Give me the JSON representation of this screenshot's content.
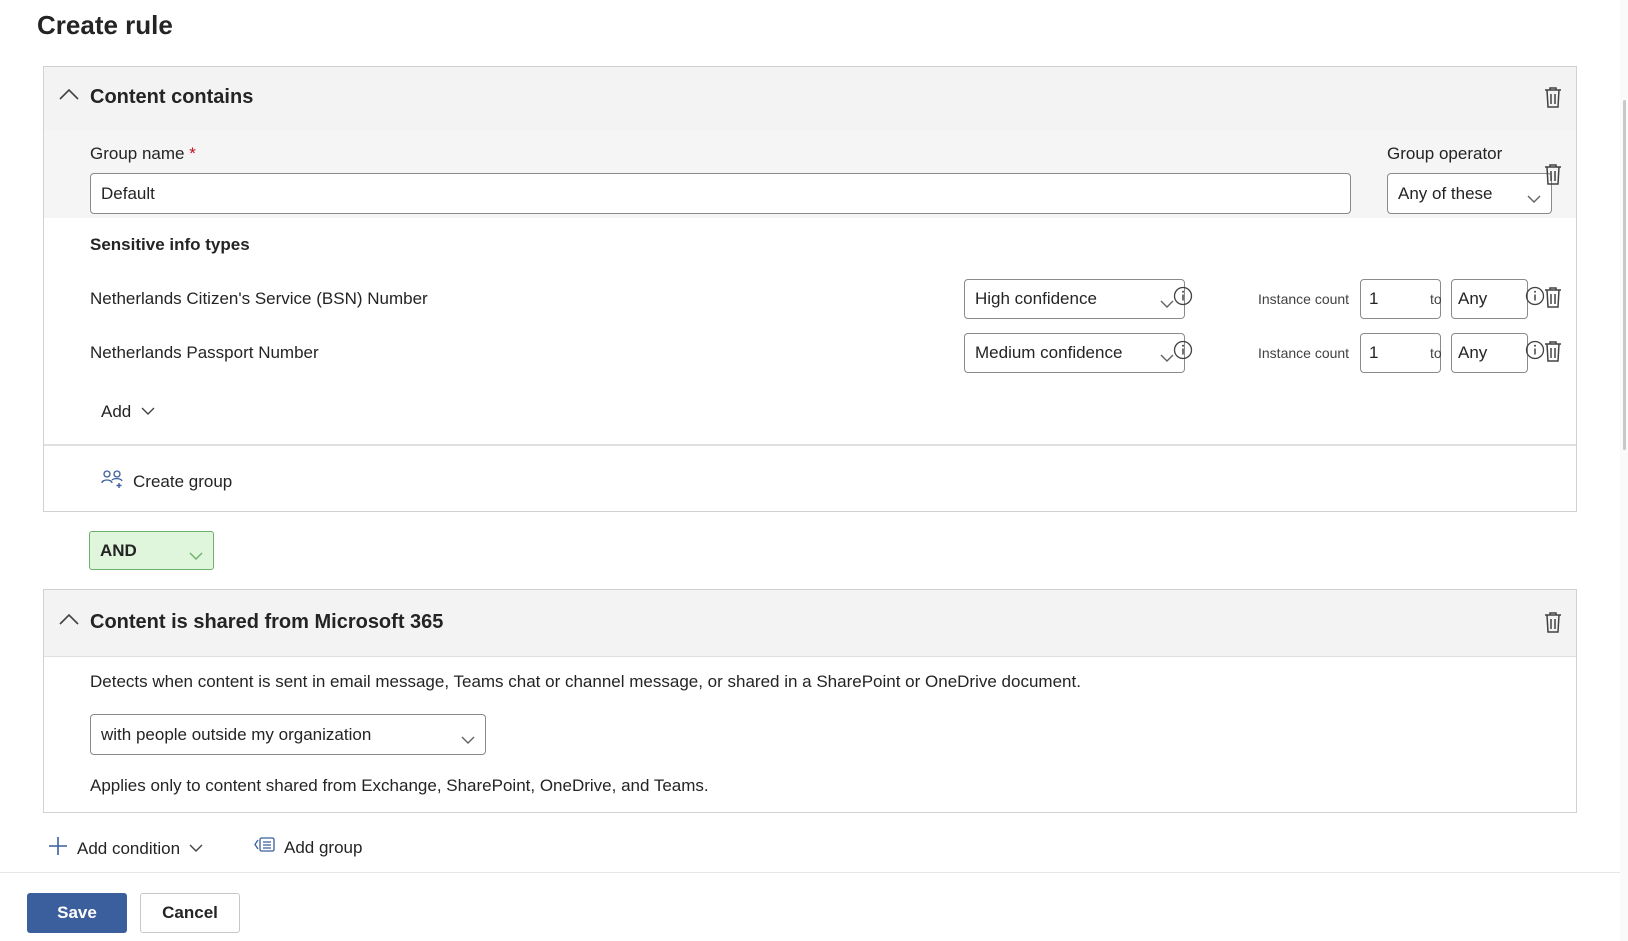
{
  "page": {
    "title": "Create rule"
  },
  "content_contains": {
    "title": "Content contains",
    "group_name_label": "Group name",
    "required_mark": "*",
    "group_name_value": "Default",
    "group_operator_label": "Group operator",
    "group_operator_value": "Any of these",
    "sit_header": "Sensitive info types",
    "items": [
      {
        "name": "Netherlands Citizen's Service (BSN) Number",
        "confidence": "High confidence",
        "instance_label": "Instance count",
        "min": "1",
        "to": "to",
        "max": "Any"
      },
      {
        "name": "Netherlands Passport Number",
        "confidence": "Medium confidence",
        "instance_label": "Instance count",
        "min": "1",
        "to": "to",
        "max": "Any"
      }
    ],
    "add_label": "Add",
    "create_group_label": "Create group"
  },
  "operator": {
    "value": "AND"
  },
  "shared": {
    "title": "Content is shared from Microsoft 365",
    "description": "Detects when content is sent in email message, Teams chat or channel message, or shared in a SharePoint or OneDrive document.",
    "scope_value": "with people outside my organization",
    "note": "Applies only to content shared from Exchange, SharePoint, OneDrive, and Teams."
  },
  "actions": {
    "add_condition": "Add condition",
    "add_group": "Add group"
  },
  "footer": {
    "save": "Save",
    "cancel": "Cancel"
  },
  "colors": {
    "primary": "#3a5f9c",
    "and_bg": "#dff6dd",
    "and_border": "#6bb16b",
    "required": "#c50f1f"
  },
  "icons": [
    "chevron-up-icon",
    "trash-icon",
    "chevron-down-icon",
    "info-icon",
    "create-group-icon",
    "plus-icon",
    "add-group-icon"
  ]
}
